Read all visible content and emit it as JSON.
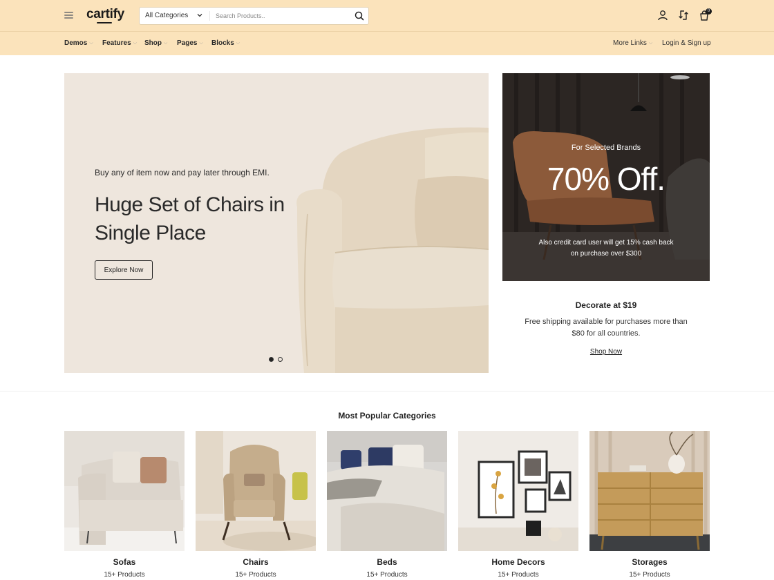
{
  "header": {
    "logo": "cartify",
    "search": {
      "category": "All Categories",
      "placeholder": "Search Products.."
    },
    "cart_count": "0",
    "icons": [
      "menu-icon",
      "search-icon",
      "user-icon",
      "compare-icon",
      "cart-icon"
    ]
  },
  "nav": {
    "items": [
      {
        "label": "Demos"
      },
      {
        "label": "Features"
      },
      {
        "label": "Shop"
      },
      {
        "label": "Pages"
      },
      {
        "label": "Blocks"
      }
    ],
    "more_links": "More Links",
    "login": "Login & Sign up"
  },
  "hero": {
    "subtitle": "Buy any of item now and pay later through EMI.",
    "title": "Huge Set of Chairs in Single Place",
    "button": "Explore Now",
    "active_slide": 1,
    "slides": 2
  },
  "promo": {
    "kicker": "For Selected Brands",
    "headline": "70% Off.",
    "note": "Also credit card user will get 15% cash back on purchase over $300"
  },
  "decorate": {
    "title": "Decorate at $19",
    "text": "Free shipping available for purchases more than $80 for all countries.",
    "link": "Shop Now"
  },
  "categories": {
    "title": "Most Popular Categories",
    "items": [
      {
        "name": "Sofas",
        "count": "15+ Products"
      },
      {
        "name": "Chairs",
        "count": "15+ Products"
      },
      {
        "name": "Beds",
        "count": "15+ Products"
      },
      {
        "name": "Home Decors",
        "count": "15+ Products"
      },
      {
        "name": "Storages",
        "count": "15+ Products"
      }
    ]
  },
  "colors": {
    "header_bg": "#fbe3bb",
    "hero_bg": "#eee6dd",
    "promo_bg": "#2a2522",
    "text_dark": "#222222"
  }
}
